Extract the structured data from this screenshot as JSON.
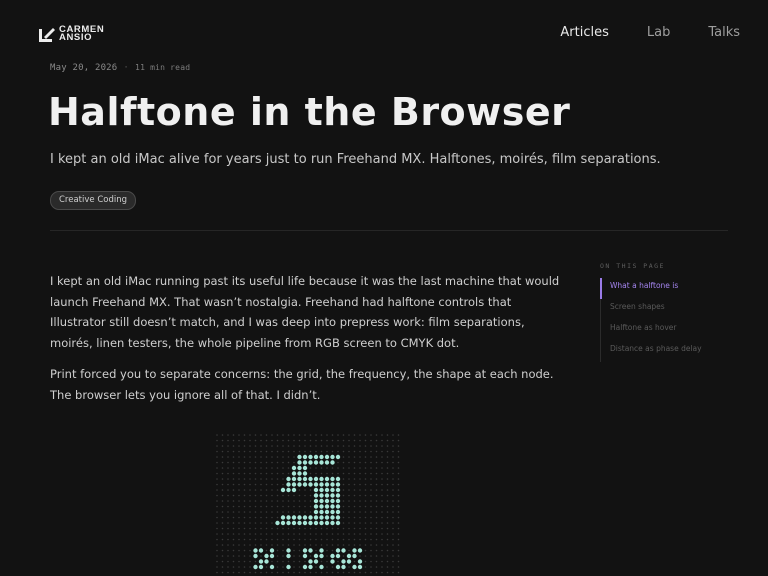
{
  "brand": {
    "line1": "CARMEN",
    "line2": "ANSIO"
  },
  "nav": {
    "items": [
      {
        "label": "Articles",
        "active": true
      },
      {
        "label": "Lab",
        "active": false
      },
      {
        "label": "Talks",
        "active": false
      }
    ]
  },
  "article": {
    "date": "May 20, 2026",
    "read_time": "11 min read",
    "title": "Halftone in the Browser",
    "subtitle": "I kept an old iMac alive for years just to run Freehand MX. Halftones, moirés, film separations.",
    "tag": "Creative Coding",
    "paragraphs": [
      "I kept an old iMac running past its useful life because it was the last machine that would launch Freehand MX. That wasn’t nostalgia. Freehand had halftone controls that Illustrator still doesn’t match, and I was deep into prepress work: film separations, moirés, linen testers, the whole pipeline from RGB screen to CMYK dot.",
      "Print forced you to separate concerns: the grid, the frequency, the shape at each node. The browser lets you ignore all of that. I didn’t."
    ]
  },
  "toc": {
    "title": "ON THIS PAGE",
    "items": [
      {
        "label": "What a halftone is",
        "active": true
      },
      {
        "label": "Screen shapes",
        "active": false
      },
      {
        "label": "Halftone as hover",
        "active": false
      },
      {
        "label": "Distance as phase delay",
        "active": false
      }
    ]
  },
  "colors": {
    "background": "#121212",
    "accent": "#a485ef",
    "halftone_dot": "#a8e6d8",
    "halftone_grid": "#3a3a3a"
  }
}
